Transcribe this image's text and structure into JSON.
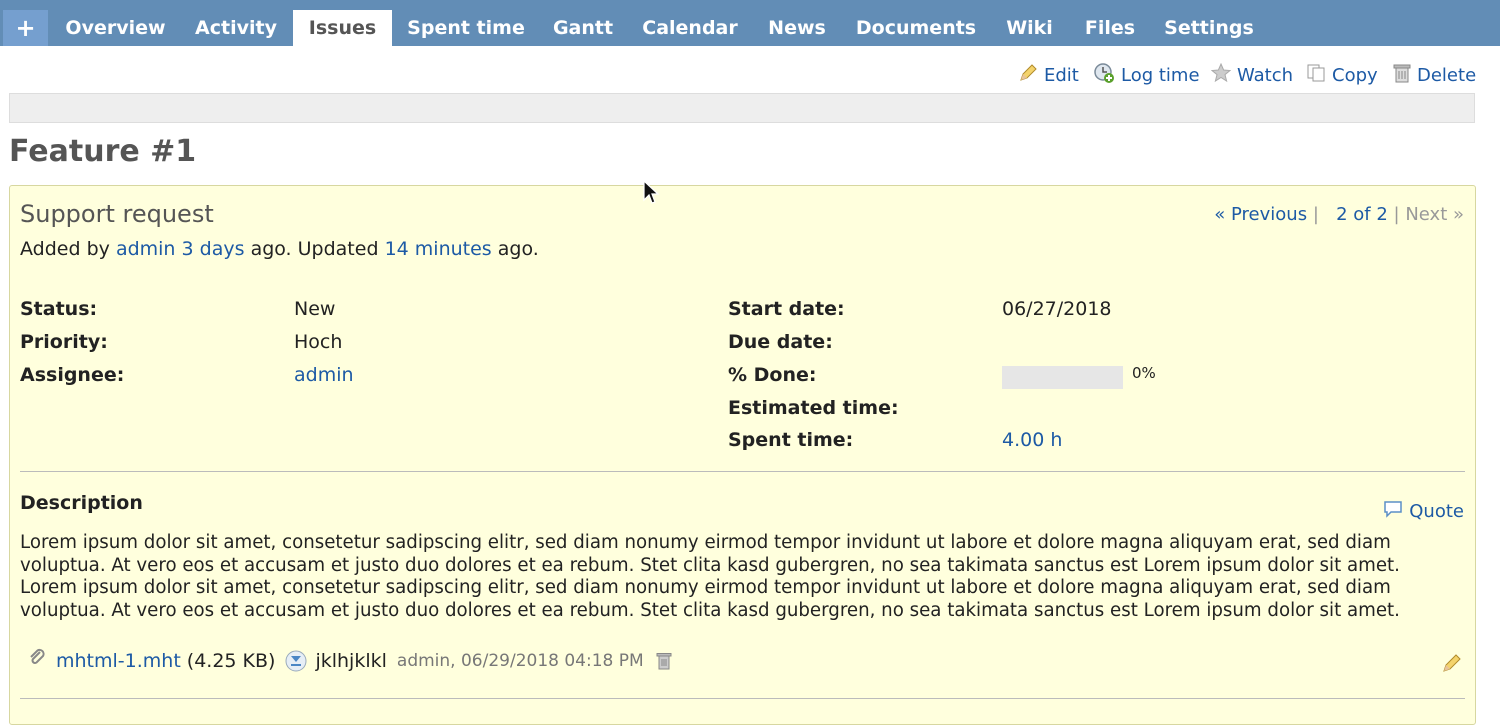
{
  "tabs": {
    "new": "+",
    "overview": "Overview",
    "activity": "Activity",
    "issues": "Issues",
    "spent_time": "Spent time",
    "gantt": "Gantt",
    "calendar": "Calendar",
    "news": "News",
    "documents": "Documents",
    "wiki": "Wiki",
    "files": "Files",
    "settings": "Settings"
  },
  "actions": {
    "edit": "Edit",
    "log_time": "Log time",
    "watch": "Watch",
    "copy": "Copy",
    "delete": "Delete"
  },
  "issue": {
    "title": "Feature #1",
    "subject": "Support request",
    "added_prefix": "Added by",
    "author": "admin",
    "created_ago": "3 days",
    "ago1": "ago. Updated",
    "updated_ago": "14 minutes",
    "ago2": "ago.",
    "nav": {
      "previous": "« Previous",
      "sep1": "|",
      "position": "2 of 2",
      "sep2": "|",
      "next": "Next »"
    },
    "attributes": {
      "status_label": "Status:",
      "status_value": "New",
      "priority_label": "Priority:",
      "priority_value": "Hoch",
      "assignee_label": "Assignee:",
      "assignee_value": "admin",
      "start_label": "Start date:",
      "start_value": "06/27/2018",
      "due_label": "Due date:",
      "due_value": "",
      "done_label": "% Done:",
      "done_value": "0%",
      "done_fraction": 0,
      "estimated_label": "Estimated time:",
      "estimated_value": "",
      "spent_label": "Spent time:",
      "spent_value": "4.00 h"
    },
    "description_title": "Description",
    "quote": "Quote",
    "description": "Lorem ipsum dolor sit amet, consetetur sadipscing elitr, sed diam nonumy eirmod tempor invidunt ut labore et dolore magna aliquyam erat, sed diam voluptua. At vero eos et accusam et justo duo dolores et ea rebum. Stet clita kasd gubergren, no sea takimata sanctus est Lorem ipsum dolor sit amet. Lorem ipsum dolor sit amet, consetetur sadipscing elitr, sed diam nonumy eirmod tempor invidunt ut labore et dolore magna aliquyam erat, sed diam voluptua. At vero eos et accusam et justo duo dolores et ea rebum. Stet clita kasd gubergren, no sea takimata sanctus est Lorem ipsum dolor sit amet.",
    "attachment": {
      "filename": "mhtml-1.mht",
      "size": "(4.25 KB)",
      "description": "jklhjklkl",
      "meta": "admin, 06/29/2018 04:18 PM"
    }
  },
  "colors": {
    "tabbar": "#628db6",
    "link": "#1d5aa5",
    "issue_bg": "#ffffdd"
  }
}
